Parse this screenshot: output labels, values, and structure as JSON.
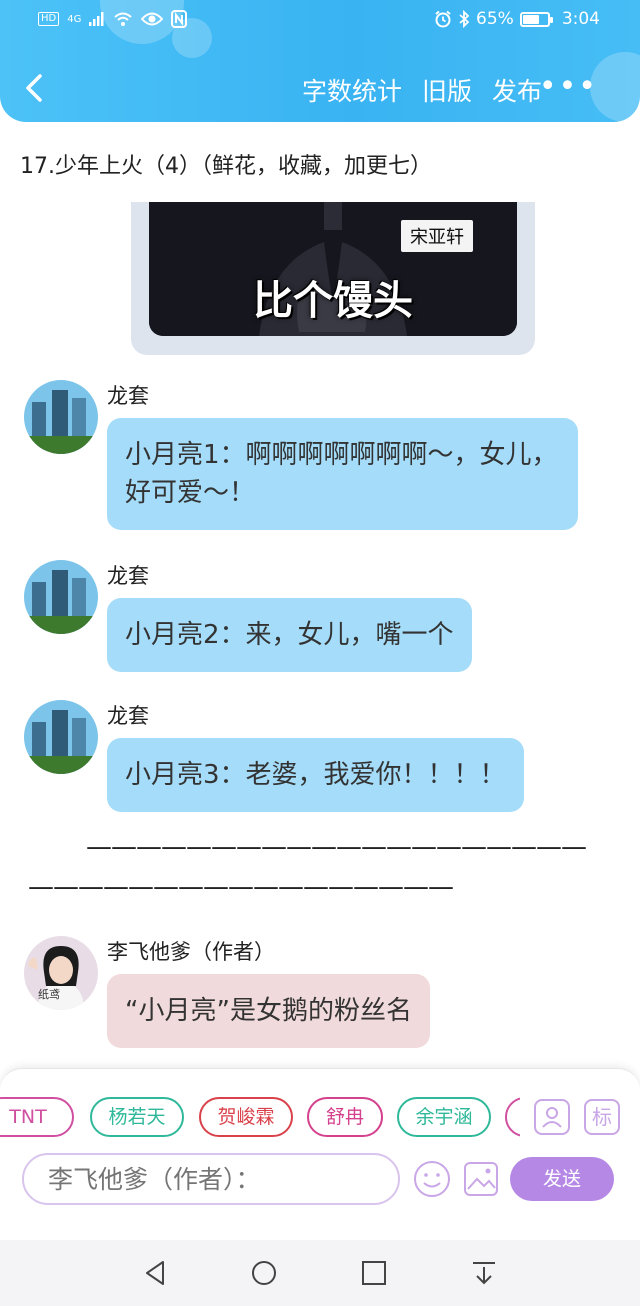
{
  "status_bar": {
    "network_label": "HD",
    "signal_label": "4G",
    "battery_percent": "65%",
    "battery_level": 0.65,
    "time": "3:04"
  },
  "toolbar": {
    "word_count_label": "字数统计",
    "old_version_label": "旧版",
    "publish_label": "发布",
    "more_label": "•••"
  },
  "chapter": {
    "title": "17.少年上火（4）（鲜花，收藏，加更七）"
  },
  "meme_image": {
    "name_tag": "宋亚轩",
    "caption": "比个馒头"
  },
  "messages": [
    {
      "sender": "龙套",
      "text": "小月亮1：啊啊啊啊啊啊啊～，女儿，好可爱～！"
    },
    {
      "sender": "龙套",
      "text": "小月亮2：来，女儿，嘴一个"
    },
    {
      "sender": "龙套",
      "text": "小月亮3：老婆，我爱你！！！！"
    }
  ],
  "divider": {
    "line1": "————————————————————",
    "line2": "—————————————————"
  },
  "author_message": {
    "sender": "李飞他爹（作者）",
    "text": "“小月亮”是女鹅的粉丝名",
    "avatar_caption": "纸鸢"
  },
  "role_chips": [
    {
      "label": "TNT",
      "color": "#d04fa0"
    },
    {
      "label": "杨若天",
      "color": "#2fb89a"
    },
    {
      "label": "贺峻霖",
      "color": "#d9424a"
    },
    {
      "label": "舒冉",
      "color": "#d4418c"
    },
    {
      "label": "余宇涵",
      "color": "#2fb89a"
    },
    {
      "label": "",
      "color": "#d04fa0"
    }
  ],
  "panel_icons": {
    "role_manage": "person-card-icon",
    "tag_label": "标"
  },
  "input": {
    "placeholder": "李飞他爹（作者）："
  },
  "send_label": "发送",
  "colors": {
    "header": "#3db7f4",
    "reader_bubble": "#a4dcf9",
    "author_bubble": "#f1dadb",
    "accent_purple": "#b688e6"
  }
}
